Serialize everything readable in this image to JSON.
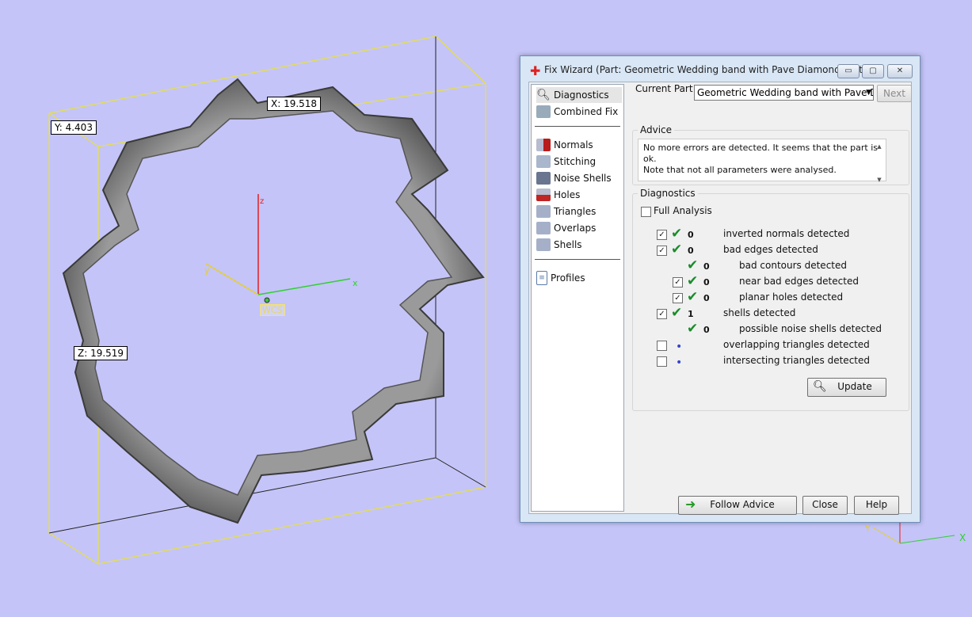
{
  "viewport": {
    "dims": {
      "x": "X: 19.518",
      "y": "Y: 4.403",
      "z": "Z: 19.519"
    },
    "axes": {
      "z": "z",
      "x": "x",
      "y": "y",
      "wcs": "WCS"
    },
    "corner_axes": {
      "x": "X",
      "y": "Y"
    }
  },
  "window": {
    "title": "Fix Wizard (Part: Geometric Wedding band with Pave Diamond Setti...",
    "min": "▭",
    "max": "▢",
    "close": "✕"
  },
  "nav": {
    "diagnostics": "Diagnostics",
    "combined_fix": "Combined Fix",
    "normals": "Normals",
    "stitching": "Stitching",
    "noise_shells": "Noise Shells",
    "holes": "Holes",
    "triangles": "Triangles",
    "overlaps": "Overlaps",
    "shells": "Shells",
    "profiles": "Profiles"
  },
  "header": {
    "current_part_label": "Current Part:",
    "current_part_value": "Geometric Wedding band with Pave Diamo",
    "next": "Next"
  },
  "advice": {
    "title": "Advice",
    "line1": "No more errors are detected. It seems that the part is ok.",
    "line2": "Note that not all parameters were analysed."
  },
  "diagnostics": {
    "title": "Diagnostics",
    "full_analysis": "Full Analysis",
    "rows": [
      {
        "count": "0",
        "label": "inverted normals detected"
      },
      {
        "count": "0",
        "label": "bad edges detected"
      },
      {
        "count": "0",
        "label": "bad contours detected"
      },
      {
        "count": "0",
        "label": "near bad edges detected"
      },
      {
        "count": "0",
        "label": "planar holes detected"
      },
      {
        "count": "1",
        "label": "shells detected"
      },
      {
        "count": "0",
        "label": "possible noise shells detected"
      },
      {
        "count": "",
        "label": "overlapping triangles detected"
      },
      {
        "count": "",
        "label": "intersecting triangles detected"
      }
    ],
    "update": "Update"
  },
  "footer": {
    "follow_advice": "Follow Advice",
    "close": "Close",
    "help": "Help"
  }
}
